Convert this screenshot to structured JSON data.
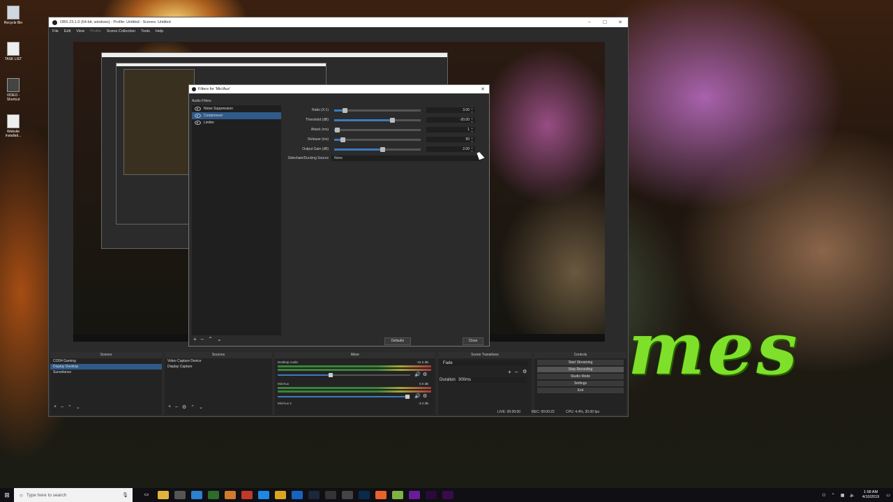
{
  "desktop": {
    "icons": [
      {
        "label": "Recycle Bin"
      },
      {
        "label": "TASK LIST"
      },
      {
        "label": "VIDEO - Shortcut"
      },
      {
        "label": "Website Installati..."
      }
    ],
    "wallpaper_text": [
      "es",
      "mes"
    ]
  },
  "obs": {
    "title": "OBS 23.1.0 (64-bit, windows) - Profile: Untitled - Scenes: Untitled",
    "menu": [
      "File",
      "Edit",
      "View",
      "Profile",
      "Scene Collection",
      "Tools",
      "Help"
    ],
    "filters_dialog": {
      "title": "Filters for 'Mic/Aux'",
      "section_label": "Audio Filters",
      "filters": [
        {
          "name": "Noise Suppression",
          "selected": false
        },
        {
          "name": "Compressor",
          "selected": true
        },
        {
          "name": "Limiter",
          "selected": false
        }
      ],
      "properties": [
        {
          "label": "Ratio (X:1)",
          "value": "3.00",
          "level": 0.12
        },
        {
          "label": "Threshold (dB)",
          "value": "-20.00",
          "level": 0.67
        },
        {
          "label": "Attack (ms)",
          "value": "1",
          "level": 0.03
        },
        {
          "label": "Release (ms)",
          "value": "50",
          "level": 0.1
        },
        {
          "label": "Output Gain (dB)",
          "value": "2.00",
          "level": 0.56
        }
      ],
      "sidechain_label": "Sidechain/Ducking Source",
      "sidechain_value": "None",
      "defaults_label": "Defaults",
      "close_label": "Close"
    },
    "docks": {
      "scenes": {
        "title": "Scenes",
        "items": [
          "COD4 Gaming",
          "Display Desktop",
          "Surveilance"
        ],
        "selected": 1
      },
      "sources": {
        "title": "Sources",
        "items": [
          "Video Capture Device",
          "Display Capture"
        ]
      },
      "mixer": {
        "title": "Mixer",
        "channels": [
          {
            "name": "Desktop Audio",
            "db": "-34.6 dB",
            "level": 0.4
          },
          {
            "name": "Mic/Aux",
            "db": "0.0 dB",
            "level": 0.98
          },
          {
            "name": "Mic/Aux 2",
            "db": "-3.3 dB"
          }
        ]
      },
      "transitions": {
        "title": "Scene Transitions",
        "transition": "Fade",
        "duration_label": "Duration",
        "duration_value": "300ms"
      },
      "controls": {
        "title": "Controls",
        "buttons": [
          "Start Streaming",
          "Stop Recording",
          "Studio Mode",
          "Settings",
          "Exit"
        ]
      }
    },
    "status": {
      "live": "LIVE: 00:00:00",
      "rec": "REC: 00:00:22",
      "cpu": "CPU: 4.4%, 30.00 fps"
    }
  },
  "taskbar": {
    "search_placeholder": "Type here to search",
    "time": "1:58 AM",
    "date": "4/10/2019"
  }
}
